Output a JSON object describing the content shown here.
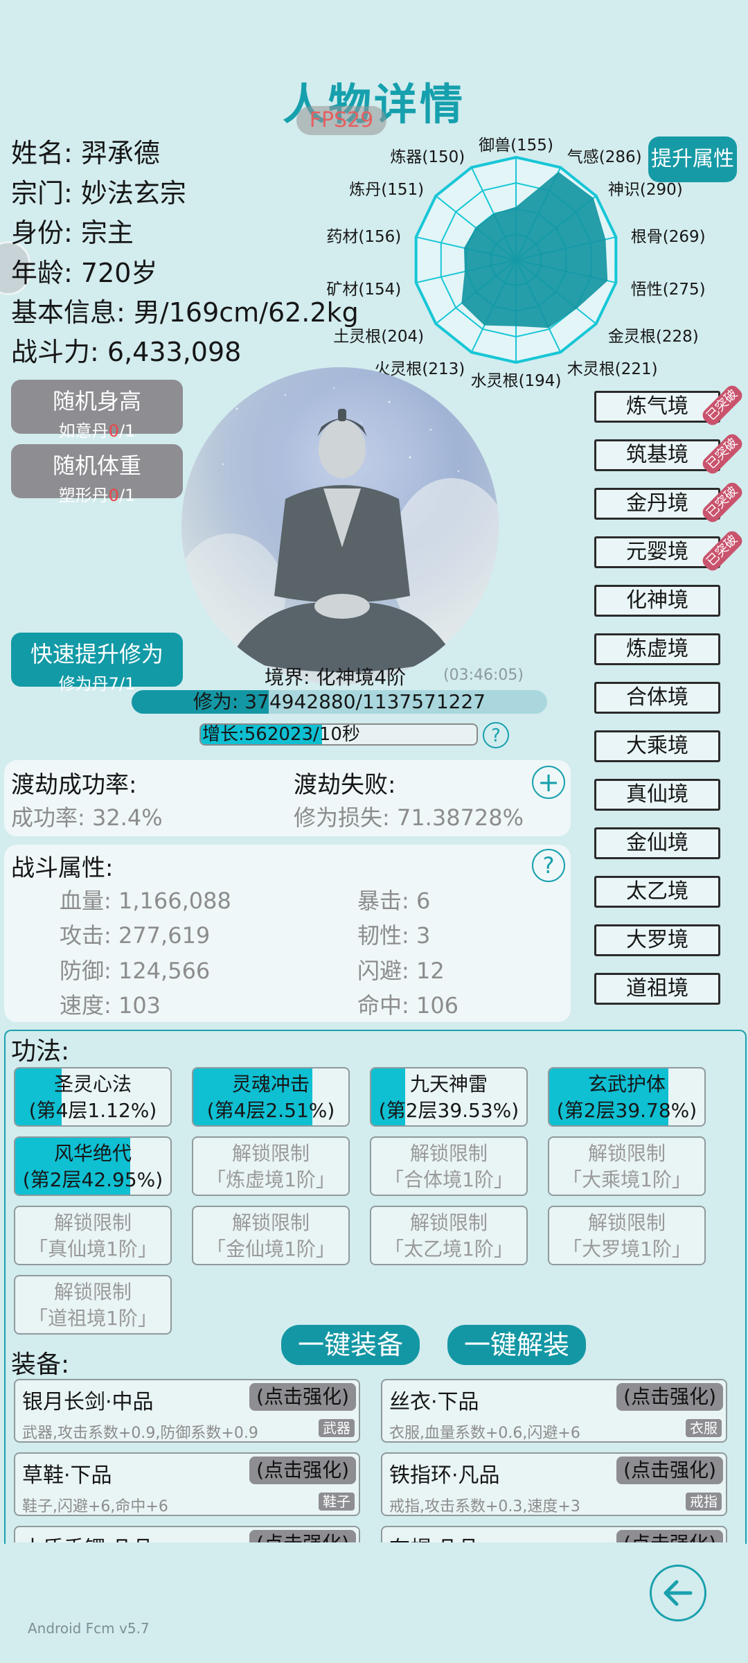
{
  "title": "人物详情",
  "fps": "FPS29",
  "info": {
    "name_label": "姓名:",
    "name": "羿承德",
    "sect_label": "宗门:",
    "sect": "妙法玄宗",
    "role_label": "身份:",
    "role": "宗主",
    "age_label": "年龄:",
    "age": "720岁",
    "basic_label": "基本信息:",
    "basic": "男/169cm/62.2kg",
    "power_label": "战斗力:",
    "power": "6,433,098"
  },
  "buttons": {
    "random_height": "随机身高",
    "random_height_item": "如意丹",
    "random_height_count": "0",
    "random_height_total": "/1",
    "random_weight": "随机体重",
    "random_weight_item": "塑形丹",
    "random_weight_count": "0",
    "random_weight_total": "/1",
    "quick_cultivate": "快速提升修为",
    "quick_cultivate_item": "修为丹7/1",
    "improve_attr": "提升属性",
    "equip_all": "一键装备",
    "unequip_all": "一键解装"
  },
  "radar": {
    "axes": [
      {
        "label": "御兽(155)",
        "value": 155
      },
      {
        "label": "气感(286)",
        "value": 286
      },
      {
        "label": "神识(290)",
        "value": 290
      },
      {
        "label": "根骨(269)",
        "value": 269
      },
      {
        "label": "悟性(275)",
        "value": 275
      },
      {
        "label": "金灵根(228)",
        "value": 228
      },
      {
        "label": "木灵根(221)",
        "value": 221
      },
      {
        "label": "水灵根(194)",
        "value": 194
      },
      {
        "label": "火灵根(213)",
        "value": 213
      },
      {
        "label": "土灵根(204)",
        "value": 204
      },
      {
        "label": "矿材(154)",
        "value": 154
      },
      {
        "label": "药材(156)",
        "value": 156
      },
      {
        "label": "炼丹(151)",
        "value": 151
      },
      {
        "label": "炼器(150)",
        "value": 150
      }
    ],
    "max": 300,
    "fill_color": "#1596a3",
    "line_color": "#17c6d6"
  },
  "realm": {
    "label": "境界: 化神境4阶",
    "time": "(03:46:05)",
    "cultivation_label": "修为: 374942880/1137571227",
    "cultivation_fraction": 0.33,
    "growth_label": "增长:562023/10秒",
    "growth_fraction": 0.44
  },
  "tribulation": {
    "success_title": "渡劫成功率:",
    "success_value": "成功率: 32.4%",
    "fail_title": "渡劫失败:",
    "fail_value": "修为损失: 71.38728%"
  },
  "combat": {
    "title": "战斗属性:",
    "stats": {
      "hp": "血量: 1,166,088",
      "crit": "暴击: 6",
      "atk": "攻击: 277,619",
      "tough": "韧性: 3",
      "def": "防御: 124,566",
      "dodge": "闪避: 12",
      "spd": "速度: 103",
      "hit": "命中: 106"
    }
  },
  "realms": {
    "list": [
      "炼气境",
      "筑基境",
      "金丹境",
      "元婴境",
      "化神境",
      "炼虚境",
      "合体境",
      "大乘境",
      "真仙境",
      "金仙境",
      "太乙境",
      "大罗境",
      "道祖境"
    ],
    "badge": "已突破"
  },
  "skills": {
    "title": "功法:",
    "items": [
      {
        "name": "圣灵心法",
        "level": "(第4层1.12%)",
        "progress": 0.3
      },
      {
        "name": "灵魂冲击",
        "level": "(第4层2.51%)",
        "progress": 0.77
      },
      {
        "name": "九天神雷",
        "level": "(第2层39.53%)",
        "progress": 0.22
      },
      {
        "name": "玄武护体",
        "level": "(第2层39.78%)",
        "progress": 0.77
      },
      {
        "name": "风华绝代",
        "level": "(第2层42.95%)",
        "progress": 0.74
      }
    ],
    "locked": [
      {
        "title": "解锁限制",
        "req": "「炼虚境1阶」"
      },
      {
        "title": "解锁限制",
        "req": "「合体境1阶」"
      },
      {
        "title": "解锁限制",
        "req": "「大乘境1阶」"
      },
      {
        "title": "解锁限制",
        "req": "「真仙境1阶」"
      },
      {
        "title": "解锁限制",
        "req": "「金仙境1阶」"
      },
      {
        "title": "解锁限制",
        "req": "「太乙境1阶」"
      },
      {
        "title": "解锁限制",
        "req": "「大罗境1阶」"
      },
      {
        "title": "解锁限制",
        "req": "「道祖境1阶」"
      }
    ]
  },
  "equipment": {
    "title": "装备:",
    "enhance": "(点击强化)",
    "items": [
      {
        "name": "银月长剑·中品",
        "desc": "武器,攻击系数+0.9,防御系数+0.9",
        "tag": "武器"
      },
      {
        "name": "丝衣·下品",
        "desc": "衣服,血量系数+0.6,闪避+6",
        "tag": "衣服"
      },
      {
        "name": "草鞋·下品",
        "desc": "鞋子,闪避+6,命中+6",
        "tag": "鞋子"
      },
      {
        "name": "铁指环·凡品",
        "desc": "戒指,攻击系数+0.3,速度+3",
        "tag": "戒指"
      },
      {
        "name": "木质手镯·凡品"
      },
      {
        "name": "布帽·凡品"
      }
    ]
  },
  "version": "Android Fcm v5.7"
}
